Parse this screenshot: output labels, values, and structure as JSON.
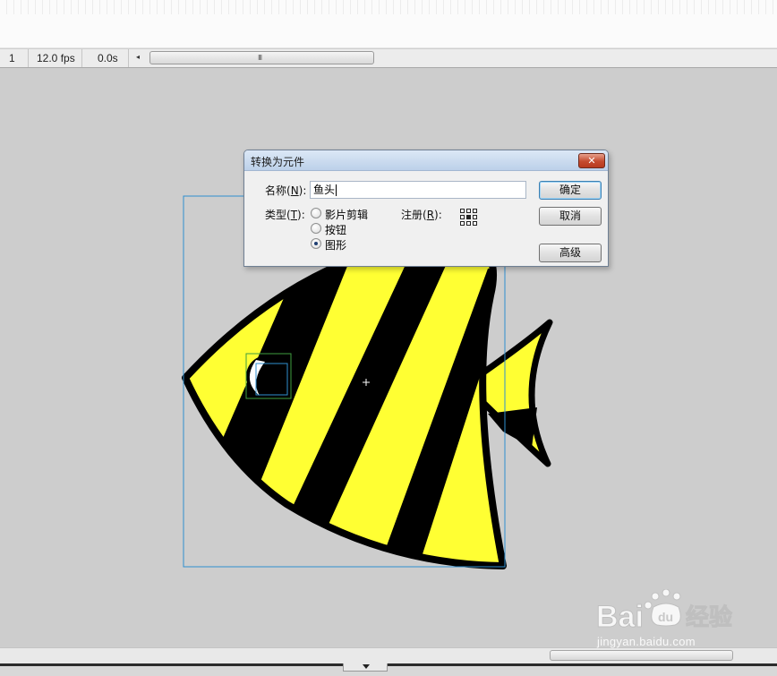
{
  "timeline": {
    "current_frame": "1",
    "frame_rate": "12.0 fps",
    "elapsed_time": "0.0s",
    "scroll_left_glyph": "◂",
    "scroll_grip_glyph": "III"
  },
  "dialog": {
    "title": "转换为元件",
    "close_glyph": "✕",
    "name_label_prefix": "名称(",
    "name_label_key": "N",
    "name_label_suffix": "):",
    "name_value": "鱼头",
    "type_label_prefix": "类型(",
    "type_label_key": "T",
    "type_label_suffix": "):",
    "type_options": [
      "影片剪辑",
      "按钮",
      "图形"
    ],
    "selected_type": "图形",
    "registration_label_prefix": "注册(",
    "registration_label_key": "R",
    "registration_label_suffix": "):",
    "buttons": {
      "ok": "确定",
      "cancel": "取消",
      "advanced": "高级"
    }
  },
  "colors": {
    "stage_background": "#cdcdcd",
    "fish_yellow": "#ffff33",
    "fish_outline": "#000000",
    "selection_box": "#2f8fd0",
    "eye_selection": "#3f9e3f"
  },
  "watermark": {
    "url": "jingyan.baidu.com"
  }
}
